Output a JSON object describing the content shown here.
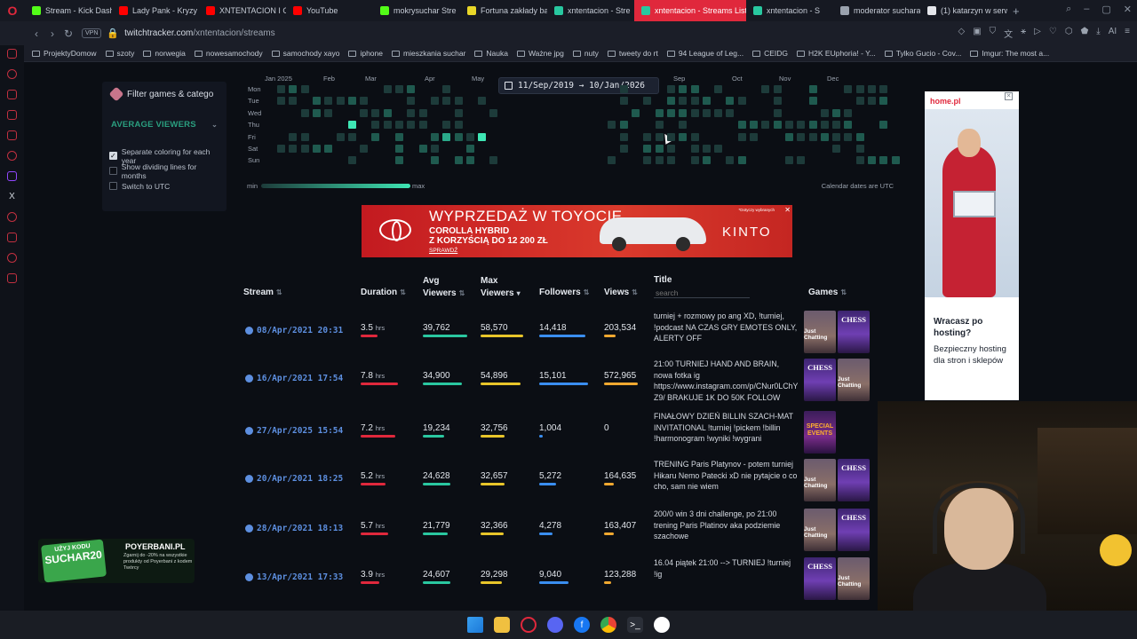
{
  "tabs": [
    {
      "label": "Stream - Kick Dash",
      "color": "#53fc18"
    },
    {
      "label": "Lady Pank - Kryzy",
      "color": "#ff0000"
    },
    {
      "label": "XNTENTACION I O",
      "color": "#ff0000"
    },
    {
      "label": "YouTube",
      "color": "#ff0000"
    },
    {
      "label": "mokrysuchar Stre",
      "color": "#53fc18"
    },
    {
      "label": "Fortuna zakłady ba",
      "color": "#e8d628"
    },
    {
      "label": "xntentacion - Stre",
      "color": "#28c8a0"
    },
    {
      "label": "xntentacion - Streams List",
      "color": "#28c8a0",
      "active": true
    },
    {
      "label": "xntentacion - S",
      "color": "#28c8a0"
    },
    {
      "label": "moderator suchara",
      "color": "#9aa2ae"
    },
    {
      "label": "(1) katarzyn w serw",
      "color": "#e4e6eb"
    }
  ],
  "address": {
    "vpn": "VPN",
    "domain": "twitchtracker.com",
    "path": "/xntentacion/streams"
  },
  "bookmarks": [
    "ProjektyDomow",
    "szoty",
    "norwegia",
    "nowesamochody",
    "samochody xayo",
    "iphone",
    "mieszkania suchar",
    "Nauka",
    "Ważne jpg",
    "nuty",
    "tweety do rt",
    "94 League of Leg...",
    "CEIDG",
    "H2K EUphoria! - Y...",
    "Tylko Gucio - Cov...",
    "Imgur: The most a..."
  ],
  "filter": {
    "button_label": "Filter games & catego",
    "metric_select": "AVERAGE VIEWERS",
    "options": [
      {
        "label": "Separate coloring for each year",
        "checked": true
      },
      {
        "label": "Show dividing lines for months",
        "checked": false
      },
      {
        "label": "Switch to UTC",
        "checked": false
      }
    ]
  },
  "heatmap": {
    "months": [
      "Jan 2025",
      "Feb",
      "Mar",
      "Apr",
      "May",
      "Sep",
      "Oct",
      "Nov",
      "Dec"
    ],
    "days": [
      "Mon",
      "Tue",
      "Wed",
      "Thu",
      "Fri",
      "Sat",
      "Sun"
    ],
    "date_range": "11/Sep/2019 → 10/Jan/2026",
    "legend_min": "min",
    "legend_max": "max",
    "note": "Calendar dates are UTC"
  },
  "ad": {
    "headline": "WYPRZEDAŻ W TOYOCIE",
    "line2": "COROLLA HYBRID",
    "line3": "Z KORZYŚCIĄ DO 12 200 ZŁ",
    "cta": "SPRAWDŹ",
    "brand": "KINTO",
    "disclaimer": "*Dotyczy wybranych"
  },
  "table": {
    "headers": {
      "stream": "Stream",
      "duration": "Duration",
      "avg": "Avg Viewers",
      "max": "Max Viewers",
      "followers": "Followers",
      "views": "Views",
      "title": "Title",
      "games": "Games"
    },
    "search_placeholder": "search",
    "rows": [
      {
        "date": "08/Apr/2021 20:31",
        "duration": "3.5",
        "avg": "39,762",
        "max": "58,570",
        "followers": "14,418",
        "views": "203,534",
        "title": "turniej + rozmowy po ang XD, !turniej, !podcast NA CZAS GRY EMOTES ONLY, ALERTY OFF",
        "games": [
          "just",
          "chess"
        ],
        "dur_frac": 0.45,
        "avg_frac": 1.0,
        "max_frac": 1.0,
        "fol_frac": 0.95,
        "views_frac": 0.35
      },
      {
        "date": "16/Apr/2021 17:54",
        "duration": "7.8",
        "avg": "34,900",
        "max": "54,896",
        "followers": "15,101",
        "views": "572,965",
        "title": "21:00 TURNIEJ HAND AND BRAIN, nowa fotka ig https://www.instagram.com/p/CNur0LChYZ9/ BRAKUJE 1K DO 50K FOLLOW",
        "games": [
          "chess",
          "just"
        ],
        "dur_frac": 1.0,
        "avg_frac": 0.88,
        "max_frac": 0.94,
        "fol_frac": 1.0,
        "views_frac": 1.0
      },
      {
        "date": "27/Apr/2025 15:54",
        "duration": "7.2",
        "avg": "19,234",
        "max": "32,756",
        "followers": "1,004",
        "views": "0",
        "title": "FINAŁOWY DZIEŃ BILLIN SZACH-MAT INVITATIONAL !turniej !pickem !billin !harmonogram !wyniki !wygrani",
        "games": [
          "special"
        ],
        "dur_frac": 0.92,
        "avg_frac": 0.48,
        "max_frac": 0.56,
        "fol_frac": 0.07,
        "views_frac": 0.0
      },
      {
        "date": "20/Apr/2021 18:25",
        "duration": "5.2",
        "avg": "24,628",
        "max": "32,657",
        "followers": "5,272",
        "views": "164,635",
        "title": "TRENING Paris Platynov - potem turniej Hikaru Nemo Patecki xD nie pytajcie o co cho, sam nie wiem",
        "games": [
          "just",
          "chess"
        ],
        "dur_frac": 0.67,
        "avg_frac": 0.62,
        "max_frac": 0.56,
        "fol_frac": 0.35,
        "views_frac": 0.29
      },
      {
        "date": "28/Apr/2021 18:13",
        "duration": "5.7",
        "avg": "21,779",
        "max": "32,366",
        "followers": "4,278",
        "views": "163,407",
        "title": "200/0 win 3 dni challenge, po 21:00 trening Paris Platinov aka podziemie szachowe",
        "games": [
          "just",
          "chess"
        ],
        "dur_frac": 0.73,
        "avg_frac": 0.55,
        "max_frac": 0.55,
        "fol_frac": 0.28,
        "views_frac": 0.29
      },
      {
        "date": "13/Apr/2021 17:33",
        "duration": "3.9",
        "avg": "24,607",
        "max": "29,298",
        "followers": "9,040",
        "views": "123,288",
        "title": "16.04 piątek 21:00 --> TURNIEJ !turniej !ig",
        "games": [
          "chess",
          "just"
        ],
        "dur_frac": 0.5,
        "avg_frac": 0.62,
        "max_frac": 0.5,
        "fol_frac": 0.6,
        "views_frac": 0.22
      }
    ],
    "duration_unit": "hrs",
    "game_labels": {
      "chess": "CHESS",
      "just": "Just Chatting",
      "special": "SPECIAL EVENTS"
    }
  },
  "right_ad": {
    "logo": "home.pl",
    "heading": "Wracasz po hosting?",
    "body": "Bezpieczny hosting dla stron i sklepów"
  },
  "promo": {
    "code_top": "UŻYJ KODU",
    "code": "SUCHAR20",
    "brand": "POYERBANI.PL",
    "desc": "Zgarnij do -20% na wszystkie produkty od Poyerbani z kodem Twórcy"
  }
}
